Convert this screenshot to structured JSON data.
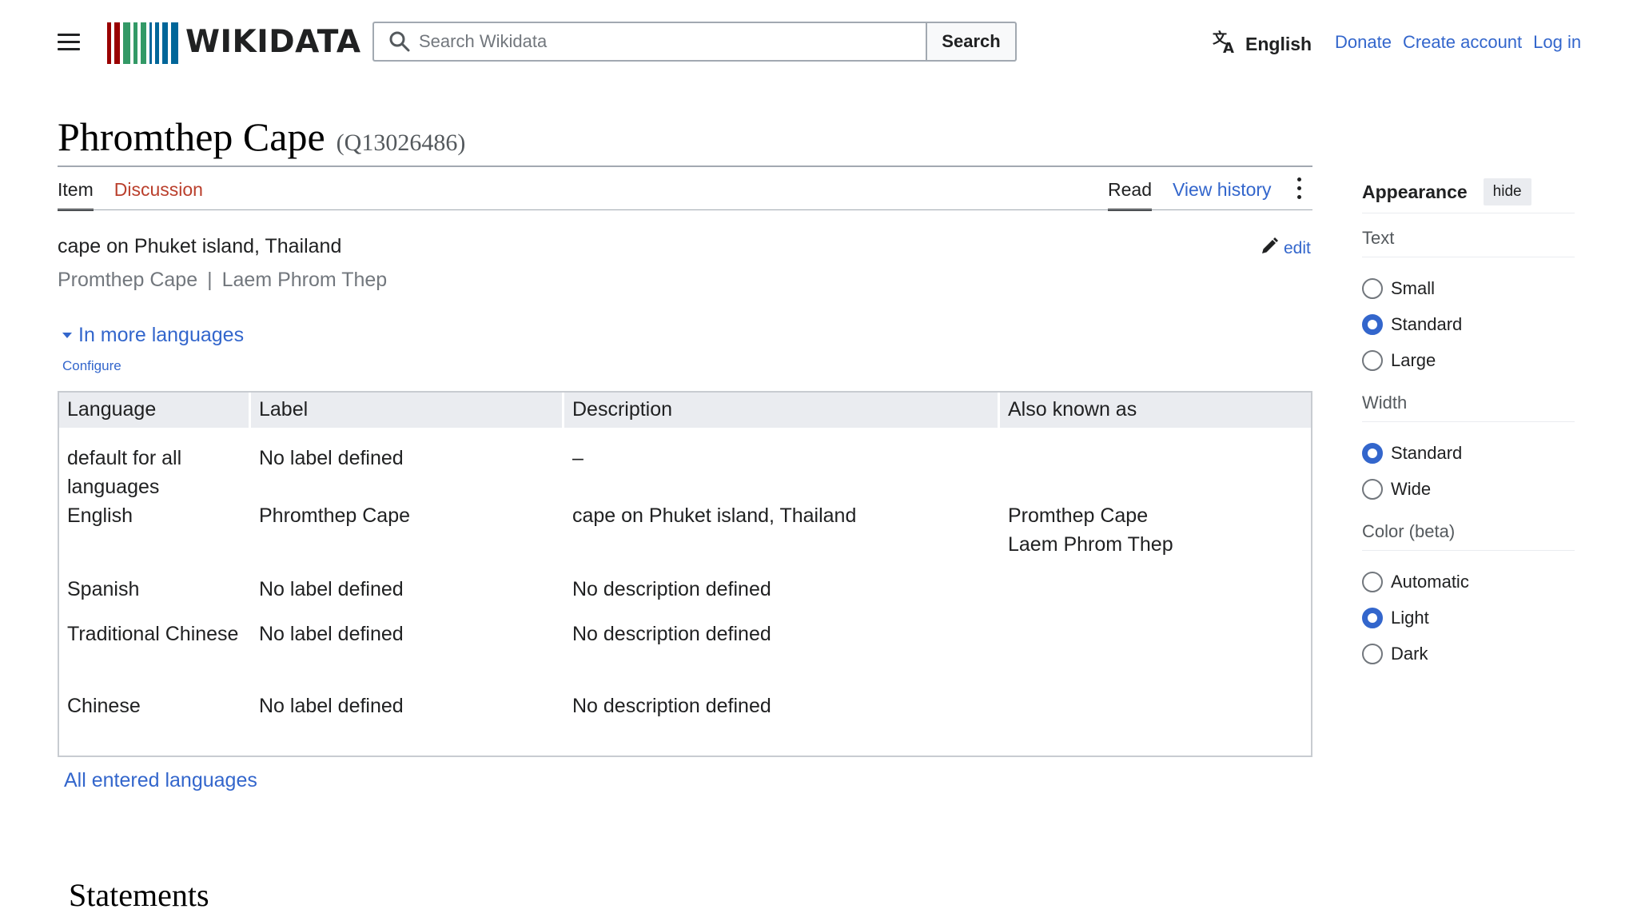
{
  "header": {
    "wordmark": "WIKIDATA",
    "search_placeholder": "Search Wikidata",
    "search_button": "Search",
    "language": "English",
    "links": [
      "Donate",
      "Create account",
      "Log in"
    ],
    "logo_colors": [
      "#990000",
      "#990000",
      "#339966",
      "#339966",
      "#339966",
      "#006699",
      "#006699",
      "#006699",
      "#006699"
    ]
  },
  "page": {
    "title": "Phromthep Cape",
    "qid": "(Q13026486)",
    "tabs_left": [
      "Item",
      "Discussion"
    ],
    "tabs_right": [
      "Read",
      "View history"
    ],
    "description": "cape on Phuket island, Thailand",
    "aliases": [
      "Promthep Cape",
      "|",
      "Laem Phrom Thep"
    ],
    "edit_label": "edit",
    "more_languages": "In more languages",
    "configure": "Configure",
    "all_languages": "All entered languages",
    "statements": "Statements"
  },
  "table": {
    "headers": [
      "Language",
      "Label",
      "Description",
      "Also known as"
    ],
    "rows": [
      {
        "language": "default for all languages",
        "label": "No label defined",
        "description": "–",
        "aka": ""
      },
      {
        "language": "English",
        "label": "Phromthep Cape",
        "description": "cape on Phuket island, Thailand",
        "aka": "Promthep Cape\nLaem Phrom Thep"
      },
      {
        "language": "Spanish",
        "label": "No label defined",
        "description": "No description defined",
        "aka": ""
      },
      {
        "language": "Traditional Chinese",
        "label": "No label defined",
        "description": "No description defined",
        "aka": ""
      },
      {
        "language": "Chinese",
        "label": "No label defined",
        "description": "No description defined",
        "aka": ""
      }
    ]
  },
  "appearance": {
    "title": "Appearance",
    "hide": "hide",
    "sections": [
      {
        "label": "Text",
        "options": [
          "Small",
          "Standard",
          "Large"
        ],
        "selected": "Standard"
      },
      {
        "label": "Width",
        "options": [
          "Standard",
          "Wide"
        ],
        "selected": "Standard"
      },
      {
        "label": "Color (beta)",
        "options": [
          "Automatic",
          "Light",
          "Dark"
        ],
        "selected": "Light"
      }
    ]
  }
}
